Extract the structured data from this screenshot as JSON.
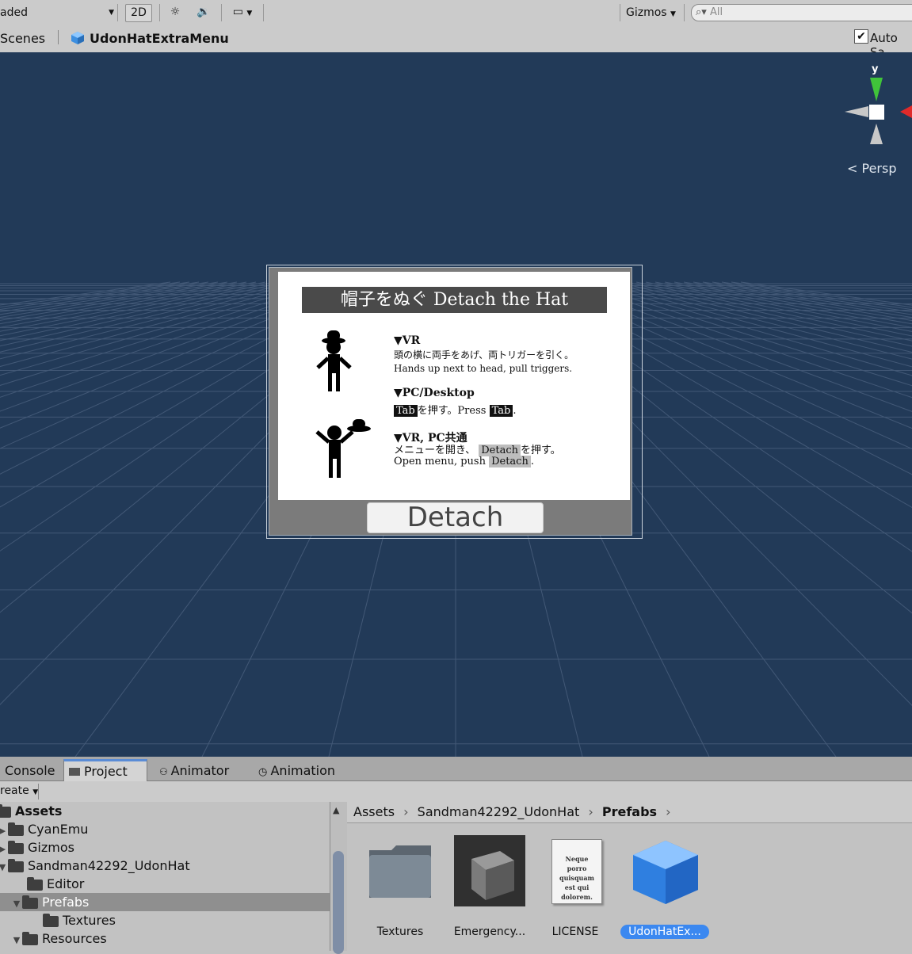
{
  "toolbar": {
    "render_mode": "aded",
    "btn_2d": "2D",
    "gizmos": "Gizmos",
    "search_placeholder": "All"
  },
  "scene_bar": {
    "scenes_label": "Scenes",
    "scene_name": "UdonHatExtraMenu",
    "auto_save": "Auto Sa"
  },
  "viewport": {
    "gizmo_axis_label": "y",
    "persp_label": "Persp"
  },
  "sign": {
    "title": "帽子をぬぐ  Detach the Hat",
    "vr_heading": "▼VR",
    "vr_line_jp": "頭の横に両手をあげ、両トリガーを引く。",
    "vr_line_en": "Hands up next to head, pull triggers.",
    "pc_heading": "▼PC/Desktop",
    "tab_key": "Tab",
    "pc_line_jp_suffix": "を押す。Press",
    "period": ".",
    "both_heading": "▼VR, PC共通",
    "both_line_jp_prefix": "メニューを開き、",
    "detach_key": "Detach",
    "both_line_jp_suffix": "を押す。",
    "both_line_en_prefix": "Open menu, push",
    "detach_button": "Detach"
  },
  "panel": {
    "tabs": [
      "Console",
      "Project",
      "Animator",
      "Animation"
    ],
    "create_label": "reate",
    "tree": [
      "Assets",
      "CyanEmu",
      "Gizmos",
      "Sandman42292_UdonHat",
      "Editor",
      "Prefabs",
      "Textures",
      "Resources"
    ],
    "breadcrumb": [
      "Assets",
      "Sandman42292_UdonHat",
      "Prefabs"
    ],
    "assets": [
      "Textures",
      "Emergency...",
      "LICENSE",
      "UdonHatEx..."
    ],
    "license_thumb_text": "Neque porro quisquam est qui dolorem."
  },
  "colors": {
    "viewport_bg": "#223a58",
    "selection_blue": "#3b88f0",
    "axis_green": "#40c43a",
    "axis_red": "#e02a2a"
  }
}
